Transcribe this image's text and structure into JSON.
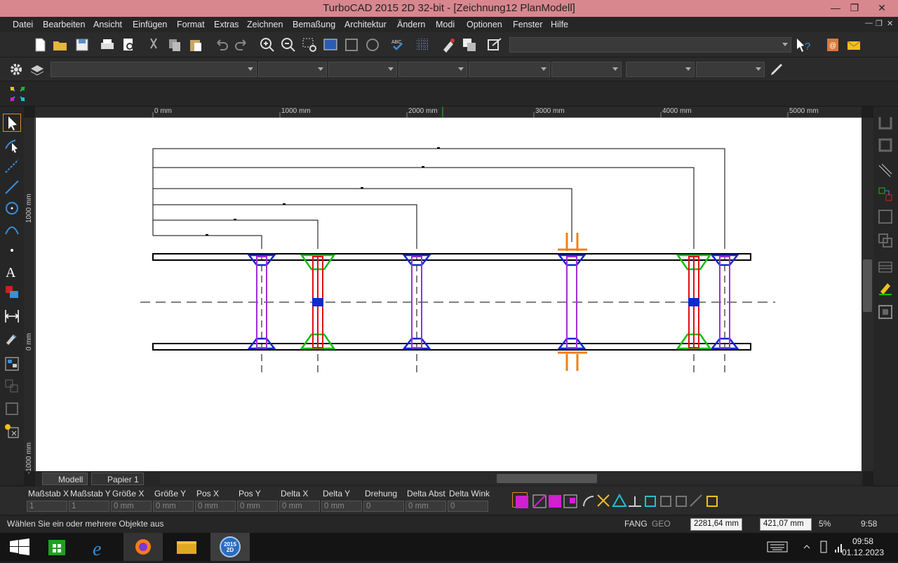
{
  "window": {
    "title": "TurboCAD 2015 2D 32-bit - [Zeichnung12 PlanModell]",
    "minimize": "—",
    "maximize": "❐",
    "close": "✕"
  },
  "menu": {
    "items": [
      "Datei",
      "Bearbeiten",
      "Ansicht",
      "Einfügen",
      "Format",
      "Extras",
      "Zeichnen",
      "Bemaßung",
      "Architektur",
      "Ändern",
      "Modi",
      "Optionen",
      "Fenster",
      "Hilfe"
    ],
    "mdi_controls": [
      "—",
      "❐",
      "✕"
    ]
  },
  "ruler": {
    "h_labels": [
      "0 mm",
      "1000 mm",
      "2000 mm",
      "3000 mm",
      "4000 mm",
      "5000 mm"
    ],
    "v_labels": [
      "1000 mm",
      "0 mm",
      "-1000 mm"
    ]
  },
  "tabs": [
    {
      "label": "Modell",
      "active": true
    },
    {
      "label": "Papier 1",
      "active": false
    }
  ],
  "properties": {
    "columns": [
      {
        "label": "Maßstab X",
        "value": "1"
      },
      {
        "label": "Maßstab Y",
        "value": "1"
      },
      {
        "label": "Größe X",
        "value": "0 mm"
      },
      {
        "label": "Größe Y",
        "value": "0 mm"
      },
      {
        "label": "Pos X",
        "value": "0 mm"
      },
      {
        "label": "Pos Y",
        "value": "0 mm"
      },
      {
        "label": "Delta X",
        "value": "0 mm"
      },
      {
        "label": "Delta Y",
        "value": "0 mm"
      },
      {
        "label": "Drehung",
        "value": "0"
      },
      {
        "label": "Delta Abst",
        "value": "0 mm"
      },
      {
        "label": "Delta Wink",
        "value": "0"
      }
    ]
  },
  "status": {
    "message": "Wählen Sie ein oder mehrere Objekte aus",
    "fang": "FANG",
    "geo": "GEO",
    "x_coord": "2281,64 mm",
    "y_coord": "421,07 mm",
    "zoom": "5%",
    "time": "9:58"
  },
  "taskbar": {
    "clock_time": "09:58",
    "clock_date": "01.12.2023",
    "turbocad_badge": "2015 2D"
  },
  "colors": {
    "titlebar": "#d8878e",
    "beam": "#000000",
    "brace_purple": "#9b30d9",
    "brace_red": "#e01010",
    "bracket_blue": "#1028d0",
    "bracket_green": "#10c010",
    "accent_orange": "#f08010"
  }
}
